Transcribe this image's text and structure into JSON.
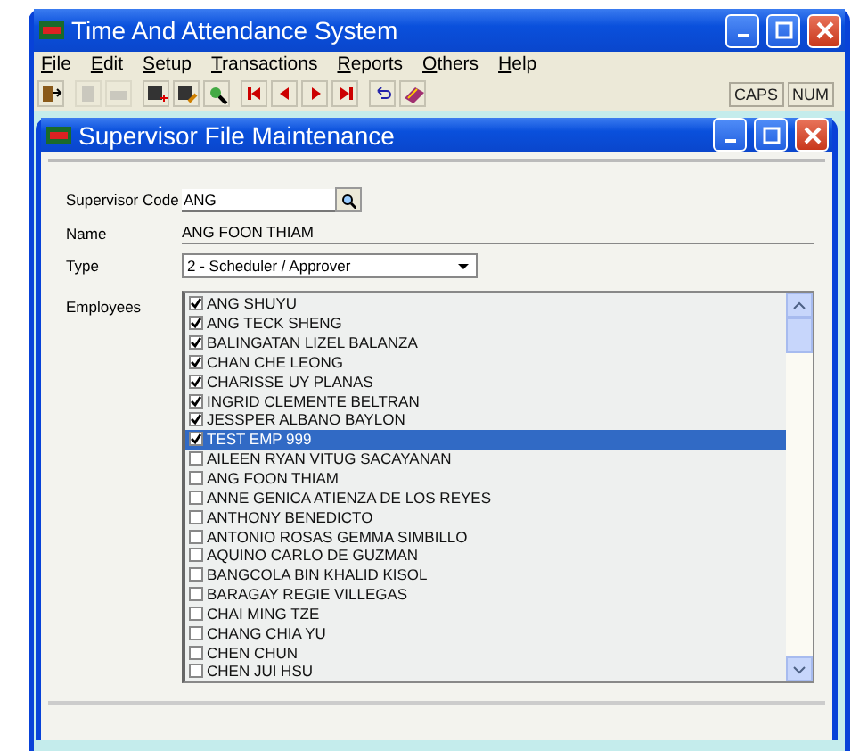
{
  "app_window": {
    "title": "Time And Attendance System"
  },
  "menu": [
    "File",
    "Edit",
    "Setup",
    "Transactions",
    "Reports",
    "Others",
    "Help"
  ],
  "toolbar": {
    "groups": [
      [
        {
          "kind": "exit",
          "disabled": false
        }
      ],
      [
        {
          "kind": "new",
          "disabled": true
        },
        {
          "kind": "print",
          "disabled": true
        }
      ],
      [
        {
          "kind": "save-add",
          "disabled": false
        },
        {
          "kind": "save-edit",
          "disabled": false
        },
        {
          "kind": "find",
          "disabled": false
        }
      ],
      [
        {
          "kind": "first",
          "disabled": false
        },
        {
          "kind": "prev",
          "disabled": false
        },
        {
          "kind": "next",
          "disabled": false
        },
        {
          "kind": "last",
          "disabled": false
        }
      ],
      [
        {
          "kind": "undo",
          "disabled": false
        },
        {
          "kind": "book",
          "disabled": false
        }
      ]
    ],
    "indicators": [
      "CAPS",
      "NUM"
    ]
  },
  "child_window": {
    "title": "Supervisor File Maintenance"
  },
  "form": {
    "supervisor_code": {
      "label": "Supervisor Code",
      "value": "ANG"
    },
    "name": {
      "label": "Name",
      "value": "ANG FOON THIAM"
    },
    "type": {
      "label": "Type",
      "value": "2 - Scheduler / Approver"
    },
    "employees": {
      "label": "Employees",
      "items": [
        {
          "name": "ANG SHUYU",
          "checked": true,
          "selected": false
        },
        {
          "name": "ANG TECK SHENG",
          "checked": true,
          "selected": false
        },
        {
          "name": "BALINGATAN LIZEL BALANZA",
          "checked": true,
          "selected": false
        },
        {
          "name": "CHAN CHE LEONG",
          "checked": true,
          "selected": false
        },
        {
          "name": "CHARISSE UY PLANAS",
          "checked": true,
          "selected": false
        },
        {
          "name": "INGRID CLEMENTE BELTRAN",
          "checked": true,
          "selected": false
        },
        {
          "name": "JESSPER ALBANO BAYLON",
          "checked": true,
          "selected": false
        },
        {
          "name": "TEST EMP 999",
          "checked": true,
          "selected": true
        },
        {
          "name": "AILEEN RYAN VITUG SACAYANAN",
          "checked": false,
          "selected": false
        },
        {
          "name": "ANG FOON THIAM",
          "checked": false,
          "selected": false
        },
        {
          "name": "ANNE GENICA ATIENZA DE LOS REYES",
          "checked": false,
          "selected": false
        },
        {
          "name": "ANTHONY BENEDICTO",
          "checked": false,
          "selected": false
        },
        {
          "name": "ANTONIO ROSAS GEMMA SIMBILLO",
          "checked": false,
          "selected": false
        },
        {
          "name": "AQUINO CARLO DE GUZMAN",
          "checked": false,
          "selected": false
        },
        {
          "name": "BANGCOLA BIN KHALID KISOL",
          "checked": false,
          "selected": false
        },
        {
          "name": "BARAGAY REGIE VILLEGAS",
          "checked": false,
          "selected": false
        },
        {
          "name": "CHAI MING TZE",
          "checked": false,
          "selected": false
        },
        {
          "name": "CHANG CHIA YU",
          "checked": false,
          "selected": false
        },
        {
          "name": "CHEN CHUN",
          "checked": false,
          "selected": false
        },
        {
          "name": "CHEN JUI HSU",
          "checked": false,
          "selected": false
        }
      ]
    }
  }
}
